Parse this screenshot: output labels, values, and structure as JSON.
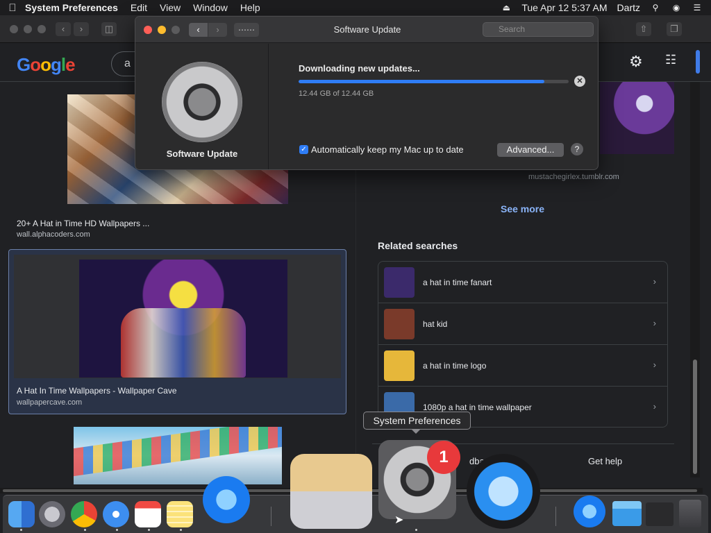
{
  "menubar": {
    "apple_icon": "apple-icon",
    "app_name": "System Preferences",
    "menus": [
      "Edit",
      "View",
      "Window",
      "Help"
    ],
    "datetime": "Tue Apr 12  5:37 AM",
    "user": "Dartz"
  },
  "google": {
    "logo": [
      "G",
      "o",
      "o",
      "g",
      "l",
      "e"
    ],
    "query": "a"
  },
  "results": {
    "left": [
      {
        "title": "20+ A Hat in Time HD Wallpapers ...",
        "domain": "wall.alphacoders.com"
      },
      {
        "title": "A Hat In Time Wallpapers - Wallpaper Cave",
        "domain": "wallpapercave.com"
      }
    ],
    "right_domain": "mustachegirlex.tumblr.com",
    "see_more": "See more",
    "related_title": "Related searches",
    "related": [
      {
        "label": "a hat in time fanart",
        "color": "#3b2a6b"
      },
      {
        "label": "hat kid",
        "color": "#7a3a2a"
      },
      {
        "label": "a hat in time logo",
        "color": "#e6b73a"
      },
      {
        "label": "1080p a hat in time wallpaper",
        "color": "#3a6aa8"
      }
    ],
    "feedback": "dback",
    "help": "Get help"
  },
  "software_update": {
    "window_title": "Software Update",
    "search_placeholder": "Search",
    "sidebar_label": "Software Update",
    "status": "Downloading new updates...",
    "progress_fraction": 0.91,
    "size_text": "12.44 GB of 12.44 GB",
    "auto_update_label": "Automatically keep my Mac up to date",
    "advanced_label": "Advanced...",
    "help_label": "?",
    "accent_color": "#2f7df6"
  },
  "dock": {
    "tooltip": "System Preferences",
    "badge": "1"
  }
}
